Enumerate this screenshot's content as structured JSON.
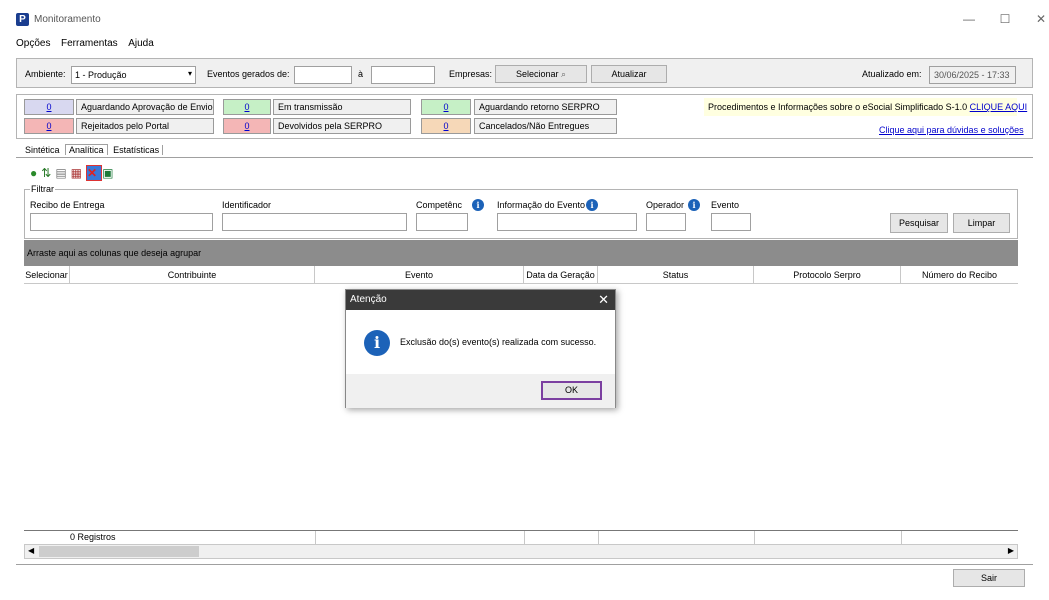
{
  "window": {
    "title": "Monitoramento",
    "logo": "P",
    "minimize": "—",
    "maximize": "☐",
    "close": "✕"
  },
  "menu": [
    "Opções",
    "Ferramentas",
    "Ajuda"
  ],
  "toolbar": {
    "ambiente_label": "Ambiente:",
    "ambiente_value": "1 - Produção",
    "eventos_label": "Eventos gerados de:",
    "a_label": "à",
    "empresas_label": "Empresas:",
    "selecionar_label": "Selecionar",
    "atualizar_label": "Atualizar",
    "atualizado_label": "Atualizado em:",
    "atualizado_value": "30/06/2025 - 17:33"
  },
  "status": {
    "aguardando_aprov": {
      "count": "0",
      "label": "Aguardando Aprovação de Envio"
    },
    "rejeitados": {
      "count": "0",
      "label": "Rejeitados pelo Portal"
    },
    "em_transmissao": {
      "count": "0",
      "label": "Em transmissão"
    },
    "devolvidos": {
      "count": "0",
      "label": "Devolvidos pela SERPRO"
    },
    "aguardando_retorno": {
      "count": "0",
      "label": "Aguardando retorno SERPRO"
    },
    "cancelados": {
      "count": "0",
      "label": "Cancelados/Não Entregues"
    }
  },
  "info": {
    "text": "Procedimentos e Informações sobre o eSocial Simplificado S-1.0",
    "link": "CLIQUE AQUI",
    "duvidas": "Clique aqui para dúvidas e soluções"
  },
  "tabs": [
    "Sintética",
    "Analítica",
    "Estatísticas"
  ],
  "filter": {
    "legend": "Filtrar",
    "recibo": "Recibo de Entrega",
    "identificador": "Identificador",
    "competencia": "Competênc",
    "informacao": "Informação do Evento",
    "operador": "Operador",
    "evento": "Evento",
    "pesquisar": "Pesquisar",
    "limpar": "Limpar"
  },
  "grid": {
    "group_hint": "Arraste aqui as colunas que deseja agrupar",
    "columns": [
      "Selecionar",
      "Contribuinte",
      "Evento",
      "Data da Geração",
      "Status",
      "Protocolo Serpro",
      "Número do Recibo"
    ],
    "footer": "0 Registros"
  },
  "dialog": {
    "title": "Atenção",
    "message": "Exclusão do(s) evento(s) realizada com sucesso.",
    "ok": "OK"
  },
  "bottom": {
    "sair": "Sair"
  },
  "colors": {
    "accent": "#1c62b8",
    "aguardando": "#d8d8f0",
    "rejeitados": "#f4b6b6",
    "transmissao": "#c6f0c6",
    "devolvidos": "#f4b6b6",
    "retorno": "#c6f0c6",
    "cancelados": "#f6d8b8",
    "info_bg": "#ffffe0"
  }
}
